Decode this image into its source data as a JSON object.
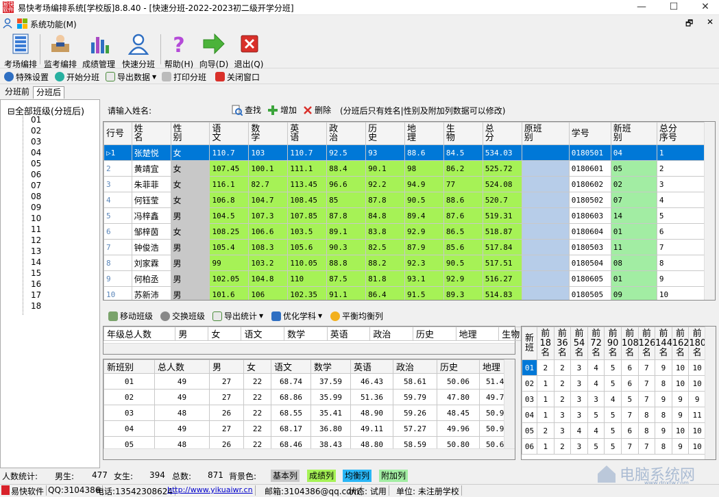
{
  "window": {
    "title": "易快考场编排系统[学校版]8.8.40 - [快速分班-2022-2023初二级开学分班]",
    "minimize": "—",
    "maximize": "☐",
    "close": "✕"
  },
  "menu": {
    "system": "系统功能(M)",
    "restore": "🗗",
    "close": "✕"
  },
  "toolbar": [
    {
      "label": "考场编排",
      "icon": "grid-icon"
    },
    {
      "label": "监考编排",
      "icon": "teacher-icon"
    },
    {
      "label": "成绩管理",
      "icon": "bar-chart-icon"
    },
    {
      "label": "快速分班",
      "icon": "user-icon"
    },
    {
      "label": "帮助(H)",
      "icon": "help-icon"
    },
    {
      "label": "向导(D)",
      "icon": "arrow-right-icon"
    },
    {
      "label": "退出(Q)",
      "icon": "exit-icon"
    }
  ],
  "toolbar2": [
    {
      "label": "特殊设置",
      "icon": "gear-icon"
    },
    {
      "label": "开始分班",
      "icon": "play-icon"
    },
    {
      "label": "导出数据",
      "icon": "export-icon"
    },
    {
      "label": "打印分班",
      "icon": "print-icon"
    },
    {
      "label": "关闭窗口",
      "icon": "close-window-icon"
    }
  ],
  "tabs": [
    "分班前",
    "分班后"
  ],
  "tree": {
    "root": "全部班级(分班后)",
    "expander": "⊟",
    "items": [
      "01",
      "02",
      "03",
      "04",
      "05",
      "06",
      "07",
      "08",
      "09",
      "10",
      "11",
      "12",
      "13",
      "14",
      "15",
      "16",
      "17",
      "18"
    ]
  },
  "search": {
    "label": "请输入姓名:",
    "value": "",
    "find": "查找",
    "add": "增加",
    "del": "删除",
    "note": "(分班后只有姓名|性别及附加列数据可以修改)"
  },
  "grid": {
    "columns": [
      "行号",
      "姓名",
      "性别",
      "语文",
      "数学",
      "英语",
      "政治",
      "历史",
      "地理",
      "生物",
      "总分",
      "原班别",
      "学号",
      "新班别",
      "总分序号"
    ],
    "rows": [
      [
        "1",
        "张楚悦",
        "女",
        "110.7",
        "103",
        "110.7",
        "92.5",
        "93",
        "88.6",
        "84.5",
        "534.03",
        "",
        "0180501",
        "04",
        "1"
      ],
      [
        "2",
        "黄靖宜",
        "女",
        "107.45",
        "100.1",
        "111.1",
        "88.4",
        "90.1",
        "98",
        "86.2",
        "525.72",
        "",
        "0180601",
        "05",
        "2"
      ],
      [
        "3",
        "朱菲菲",
        "女",
        "116.1",
        "82.7",
        "113.45",
        "96.6",
        "92.2",
        "94.9",
        "77",
        "524.08",
        "",
        "0180602",
        "02",
        "3"
      ],
      [
        "4",
        "何钰莹",
        "女",
        "106.8",
        "104.7",
        "108.45",
        "85",
        "87.8",
        "90.5",
        "88.6",
        "520.7",
        "",
        "0180502",
        "07",
        "4"
      ],
      [
        "5",
        "冯梓鑫",
        "男",
        "104.5",
        "107.3",
        "107.85",
        "87.8",
        "84.8",
        "89.4",
        "87.6",
        "519.31",
        "",
        "0180603",
        "14",
        "5"
      ],
      [
        "6",
        "邹梓茵",
        "女",
        "108.25",
        "106.6",
        "103.5",
        "89.1",
        "83.8",
        "92.9",
        "86.5",
        "518.87",
        "",
        "0180604",
        "01",
        "6"
      ],
      [
        "7",
        "钟俊浩",
        "男",
        "105.4",
        "108.3",
        "105.6",
        "90.3",
        "82.5",
        "87.9",
        "85.6",
        "517.84",
        "",
        "0180503",
        "11",
        "7"
      ],
      [
        "8",
        "刘家霖",
        "男",
        "99",
        "103.2",
        "110.05",
        "88.8",
        "88.2",
        "92.3",
        "90.5",
        "517.51",
        "",
        "0180504",
        "08",
        "8"
      ],
      [
        "9",
        "何柏丞",
        "男",
        "102.05",
        "104.8",
        "110",
        "87.5",
        "81.8",
        "93.1",
        "92.9",
        "516.27",
        "",
        "0180605",
        "01",
        "9"
      ],
      [
        "10",
        "苏新沛",
        "男",
        "101.6",
        "106",
        "102.35",
        "91.1",
        "86.4",
        "91.5",
        "89.3",
        "514.83",
        "",
        "0180505",
        "09",
        "10"
      ]
    ]
  },
  "toolbar3": [
    {
      "label": "移动班级",
      "icon": "move-icon"
    },
    {
      "label": "交换班级",
      "icon": "swap-icon"
    },
    {
      "label": "导出统计",
      "icon": "export-icon"
    },
    {
      "label": "优化学科",
      "icon": "optimize-icon"
    },
    {
      "label": "平衡均衡列",
      "icon": "balance-icon"
    }
  ],
  "summary": {
    "columns": [
      "年级总人数",
      "男",
      "女",
      "语文",
      "数学",
      "英语",
      "政治",
      "历史",
      "地理",
      "生物"
    ]
  },
  "classstats": {
    "columns": [
      "新班别",
      "总人数",
      "男",
      "女",
      "语文",
      "数学",
      "英语",
      "政治",
      "历史",
      "地理"
    ],
    "rows": [
      [
        "01",
        "49",
        "27",
        "22",
        "68.74",
        "37.59",
        "46.43",
        "58.61",
        "50.06",
        "51.48"
      ],
      [
        "02",
        "49",
        "27",
        "22",
        "68.86",
        "35.99",
        "51.36",
        "59.79",
        "47.80",
        "49.75"
      ],
      [
        "03",
        "48",
        "26",
        "22",
        "68.55",
        "35.41",
        "48.90",
        "59.26",
        "48.45",
        "50.94"
      ],
      [
        "04",
        "49",
        "27",
        "22",
        "68.17",
        "36.80",
        "49.11",
        "57.27",
        "49.96",
        "50.90"
      ],
      [
        "05",
        "48",
        "26",
        "22",
        "68.46",
        "38.43",
        "48.80",
        "58.59",
        "50.80",
        "50.66"
      ]
    ]
  },
  "rank": {
    "columns": [
      "新\n班",
      "前\n18\n名",
      "前\n36\n名",
      "前\n54\n名",
      "前\n72\n名",
      "前\n90\n名",
      "前\n108\n名",
      "前\n126\n名",
      "前\n144\n名",
      "前\n162\n名",
      "前\n180\n名"
    ],
    "rows": [
      [
        "01",
        "2",
        "2",
        "3",
        "4",
        "5",
        "6",
        "7",
        "9",
        "10",
        "10"
      ],
      [
        "02",
        "1",
        "2",
        "3",
        "4",
        "5",
        "6",
        "7",
        "8",
        "10",
        "10"
      ],
      [
        "03",
        "1",
        "2",
        "3",
        "3",
        "4",
        "5",
        "7",
        "9",
        "9",
        "9"
      ],
      [
        "04",
        "1",
        "3",
        "3",
        "5",
        "5",
        "7",
        "8",
        "8",
        "9",
        "11"
      ],
      [
        "05",
        "2",
        "3",
        "4",
        "4",
        "5",
        "6",
        "8",
        "9",
        "10",
        "10"
      ],
      [
        "06",
        "1",
        "2",
        "3",
        "5",
        "5",
        "7",
        "7",
        "8",
        "9",
        "10"
      ]
    ]
  },
  "stats": {
    "label": "人数统计:",
    "male_label": "男生:",
    "male": "477",
    "female_label": "女生:",
    "female": "394",
    "total_label": "总数:",
    "total": "871",
    "bg_label": "背景色:",
    "legend_basic": "基本列",
    "legend_score": "成绩列",
    "legend_balance": "均衡列",
    "legend_extra": "附加列"
  },
  "statusbar": {
    "app": "易快软件",
    "qq": "QQ:3104386",
    "phone": "电话:13542308624",
    "url": "http://www.yikuaiwr.cn",
    "email": "邮箱:3104386@qq.com",
    "state": "状态: 试用",
    "unit": "单位: 未注册学校"
  },
  "watermark": {
    "text": "电脑系统网",
    "sub": "www.dnxtw.com"
  },
  "colors": {
    "basic": "#c8c8c8",
    "score": "#a6f256",
    "balance": "#b7cde9",
    "extra": "#a2eda3",
    "selected": "#0078d7"
  }
}
